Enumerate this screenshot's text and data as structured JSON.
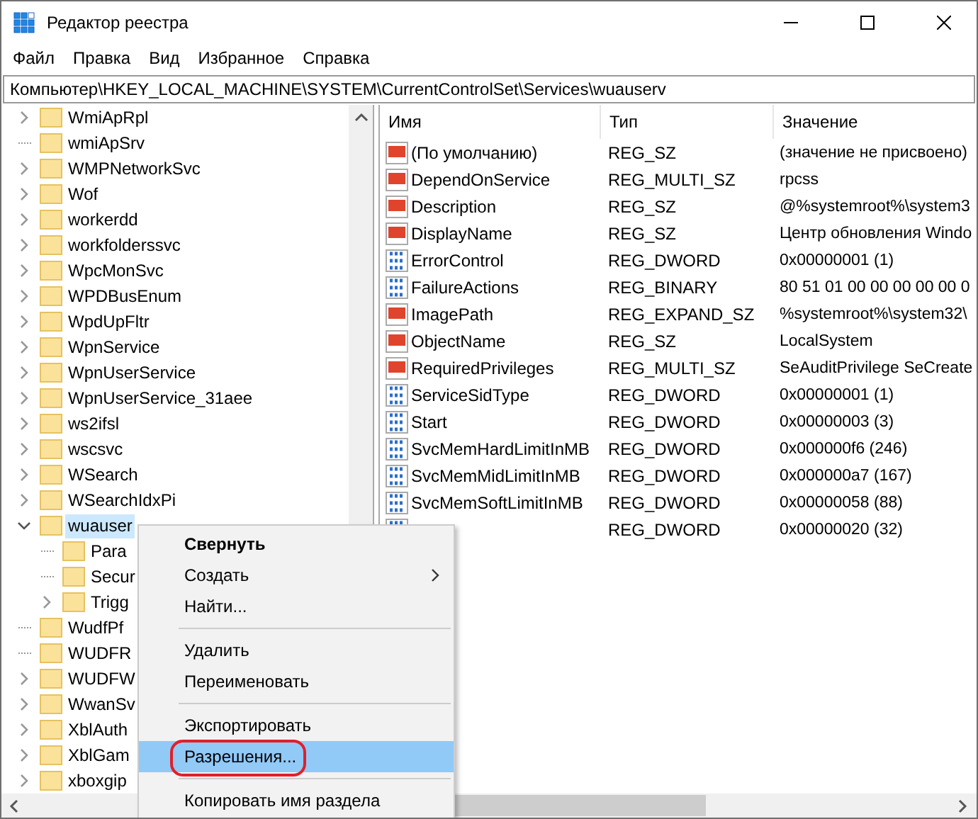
{
  "window": {
    "title": "Редактор реестра"
  },
  "menu_bar": [
    "Файл",
    "Правка",
    "Вид",
    "Избранное",
    "Справка"
  ],
  "address": "Компьютер\\HKEY_LOCAL_MACHINE\\SYSTEM\\CurrentControlSet\\Services\\wuauserv",
  "tree": [
    {
      "label": "WmiApRpl",
      "kind": "collapsed",
      "selected": false
    },
    {
      "label": "wmiApSrv",
      "kind": "leaf",
      "selected": false
    },
    {
      "label": "WMPNetworkSvc",
      "kind": "collapsed",
      "selected": false
    },
    {
      "label": "Wof",
      "kind": "collapsed",
      "selected": false
    },
    {
      "label": "workerdd",
      "kind": "collapsed",
      "selected": false
    },
    {
      "label": "workfolderssvc",
      "kind": "collapsed",
      "selected": false
    },
    {
      "label": "WpcMonSvc",
      "kind": "collapsed",
      "selected": false
    },
    {
      "label": "WPDBusEnum",
      "kind": "collapsed",
      "selected": false
    },
    {
      "label": "WpdUpFltr",
      "kind": "collapsed",
      "selected": false
    },
    {
      "label": "WpnService",
      "kind": "collapsed",
      "selected": false
    },
    {
      "label": "WpnUserService",
      "kind": "collapsed",
      "selected": false
    },
    {
      "label": "WpnUserService_31aee",
      "kind": "collapsed",
      "selected": false
    },
    {
      "label": "ws2ifsl",
      "kind": "collapsed",
      "selected": false
    },
    {
      "label": "wscsvc",
      "kind": "collapsed",
      "selected": false
    },
    {
      "label": "WSearch",
      "kind": "collapsed",
      "selected": false
    },
    {
      "label": "WSearchIdxPi",
      "kind": "collapsed",
      "selected": false
    },
    {
      "label": "wuauser",
      "kind": "expanded",
      "selected": true,
      "children": [
        {
          "label": "Para",
          "kind": "leaf",
          "selected": false
        },
        {
          "label": "Secur",
          "kind": "leaf",
          "selected": false
        },
        {
          "label": "Trigg",
          "kind": "collapsed",
          "selected": false
        }
      ]
    },
    {
      "label": "WudfPf",
      "kind": "leaf",
      "selected": false
    },
    {
      "label": "WUDFR",
      "kind": "leaf",
      "selected": false
    },
    {
      "label": "WUDFW",
      "kind": "collapsed",
      "selected": false
    },
    {
      "label": "WwanSv",
      "kind": "collapsed",
      "selected": false
    },
    {
      "label": "XblAuth",
      "kind": "collapsed",
      "selected": false
    },
    {
      "label": "XblGam",
      "kind": "collapsed",
      "selected": false
    },
    {
      "label": "xboxgip",
      "kind": "collapsed",
      "selected": false
    }
  ],
  "table": {
    "columns": [
      "Имя",
      "Тип",
      "Значение"
    ],
    "rows": [
      {
        "kind": "string",
        "name": "(По умолчанию)",
        "type": "REG_SZ",
        "data": "(значение не присвоено)"
      },
      {
        "kind": "string",
        "name": "DependOnService",
        "type": "REG_MULTI_SZ",
        "data": "rpcss"
      },
      {
        "kind": "string",
        "name": "Description",
        "type": "REG_SZ",
        "data": "@%systemroot%\\system3"
      },
      {
        "kind": "string",
        "name": "DisplayName",
        "type": "REG_SZ",
        "data": "Центр обновления Windo"
      },
      {
        "kind": "binary",
        "name": "ErrorControl",
        "type": "REG_DWORD",
        "data": "0x00000001 (1)"
      },
      {
        "kind": "binary",
        "name": "FailureActions",
        "type": "REG_BINARY",
        "data": "80 51 01 00 00 00 00 00 0"
      },
      {
        "kind": "string",
        "name": "ImagePath",
        "type": "REG_EXPAND_SZ",
        "data": "%systemroot%\\system32\\"
      },
      {
        "kind": "string",
        "name": "ObjectName",
        "type": "REG_SZ",
        "data": "LocalSystem"
      },
      {
        "kind": "string",
        "name": "RequiredPrivileges",
        "type": "REG_MULTI_SZ",
        "data": "SeAuditPrivilege SeCreate"
      },
      {
        "kind": "binary",
        "name": "ServiceSidType",
        "type": "REG_DWORD",
        "data": "0x00000001 (1)"
      },
      {
        "kind": "binary",
        "name": "Start",
        "type": "REG_DWORD",
        "data": "0x00000003 (3)"
      },
      {
        "kind": "binary",
        "name": "SvcMemHardLimitInMB",
        "type": "REG_DWORD",
        "data": "0x000000f6 (246)"
      },
      {
        "kind": "binary",
        "name": "SvcMemMidLimitInMB",
        "type": "REG_DWORD",
        "data": "0x000000a7 (167)"
      },
      {
        "kind": "binary",
        "name": "SvcMemSoftLimitInMB",
        "type": "REG_DWORD",
        "data": "0x00000058 (88)"
      },
      {
        "kind": "binary",
        "type": "REG_DWORD",
        "data": "0x00000020 (32)"
      }
    ]
  },
  "context_menu": [
    {
      "kind": "item",
      "label": "Свернуть",
      "bold": true,
      "submenu": false,
      "selected": false,
      "circled": false
    },
    {
      "kind": "item",
      "label": "Создать",
      "bold": false,
      "submenu": true,
      "selected": false,
      "circled": false
    },
    {
      "kind": "item",
      "label": "Найти...",
      "bold": false,
      "submenu": false,
      "selected": false,
      "circled": false
    },
    {
      "kind": "separator"
    },
    {
      "kind": "item",
      "label": "Удалить",
      "bold": false,
      "submenu": false,
      "selected": false,
      "circled": false
    },
    {
      "kind": "item",
      "label": "Переименовать",
      "bold": false,
      "submenu": false,
      "selected": false,
      "circled": false
    },
    {
      "kind": "separator"
    },
    {
      "kind": "item",
      "label": "Экспортировать",
      "bold": false,
      "submenu": false,
      "selected": false,
      "circled": false
    },
    {
      "kind": "item",
      "label": "Разрешения...",
      "bold": false,
      "submenu": false,
      "selected": true,
      "circled": true
    },
    {
      "kind": "separator"
    },
    {
      "kind": "item",
      "label": "Копировать имя раздела",
      "bold": false,
      "submenu": false,
      "selected": false,
      "circled": false
    }
  ]
}
